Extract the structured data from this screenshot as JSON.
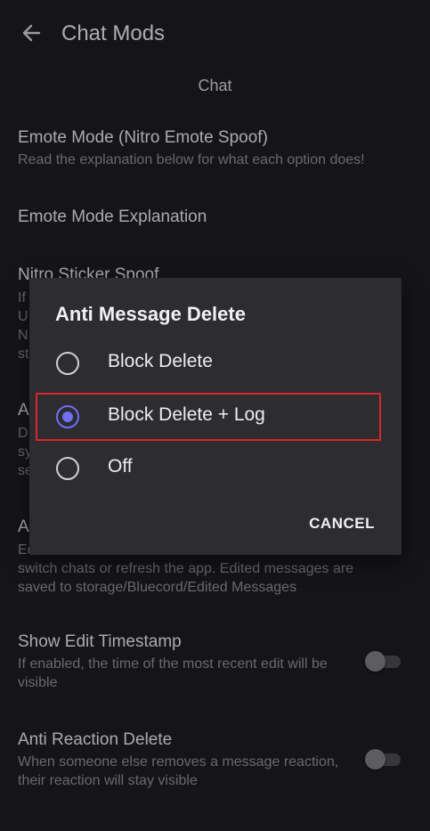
{
  "appbar": {
    "title": "Chat Mods"
  },
  "section": {
    "header": "Chat"
  },
  "settings": {
    "emote_mode": {
      "title": "Emote Mode (Nitro Emote Spoof)",
      "subtitle": "Read the explanation below for what each option does!"
    },
    "emote_explanation": {
      "title": "Emote Mode Explanation"
    },
    "nitro_sticker": {
      "title": "Nitro Sticker Spoof",
      "subtitle_fragment": [
        "If",
        "U",
        "N",
        "st"
      ]
    },
    "anti_delete": {
      "title_fragment": "A",
      "subtitle_fragment": [
        "D",
        "sy",
        "se"
      ]
    },
    "anti_edit": {
      "title_fragment": "A",
      "subtitle_line1_fragment": "Ed",
      "subtitle_rest": "switch chats or refresh the app. Edited messages are saved to storage/Bluecord/Edited Messages"
    },
    "show_edit_timestamp": {
      "title": "Show Edit Timestamp",
      "subtitle": "If enabled, the time of the most recent edit will be visible",
      "enabled": false
    },
    "anti_reaction_delete": {
      "title": "Anti Reaction Delete",
      "subtitle": "When someone else removes a message reaction, their reaction will stay visible",
      "enabled": false
    }
  },
  "dialog": {
    "title": "Anti Message Delete",
    "options": [
      {
        "label": "Block Delete",
        "selected": false
      },
      {
        "label": "Block Delete + Log",
        "selected": true
      },
      {
        "label": "Off",
        "selected": false
      }
    ],
    "cancel_label": "CANCEL"
  },
  "colors": {
    "accent": "#6f6ff0",
    "highlight_box": "#d8262c",
    "background": "#1d1d20",
    "dialog": "#2c2c31"
  }
}
